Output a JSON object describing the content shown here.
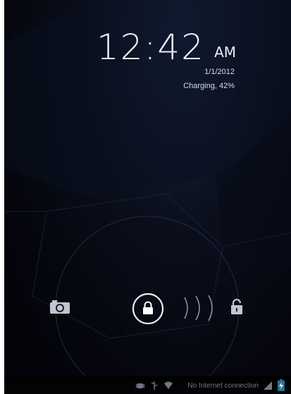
{
  "lockscreen": {
    "time": "12:42",
    "ampm": "AM",
    "date": "1/1/2012",
    "battery_status": "Charging, 42%"
  },
  "unlock": {
    "left_target_icon": "camera-icon",
    "right_target_icon": "unlock-icon",
    "handle_icon": "lock-icon"
  },
  "status_bar": {
    "network_text": "No Internet connection",
    "icons": [
      "android-debug-icon",
      "usb-icon",
      "wifi-icon",
      "signal-icon",
      "battery-charging-icon"
    ]
  },
  "colors": {
    "background": "#05060d",
    "text": "#e9eef7",
    "status_text": "#6e7686",
    "accent": "#33b5e5"
  }
}
